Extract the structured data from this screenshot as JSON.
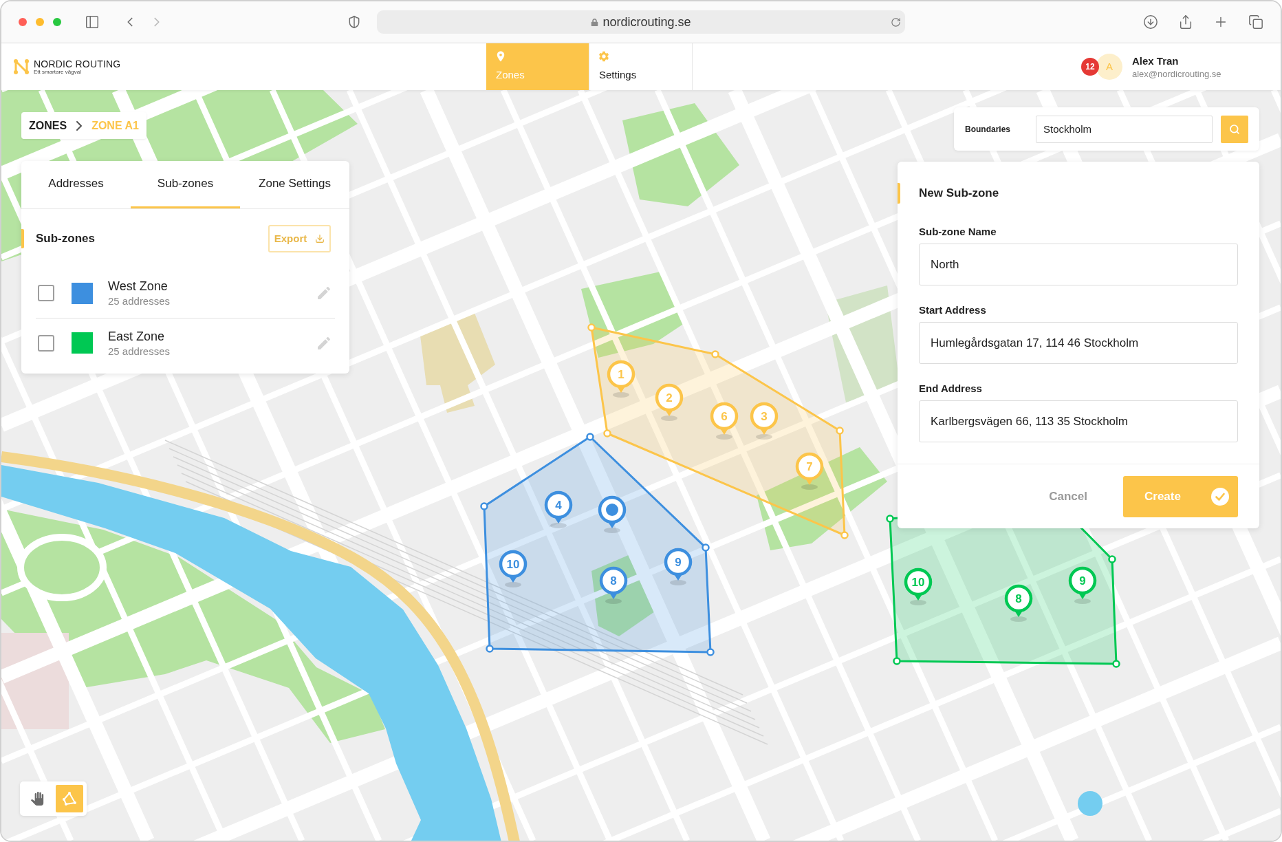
{
  "browser": {
    "url": "nordicrouting.se"
  },
  "header": {
    "brand": "NORDIC ROUTING",
    "tagline": "Ett smartare vägval",
    "nav": [
      {
        "label": "Zones",
        "selected": true
      },
      {
        "label": "Settings",
        "selected": false
      }
    ],
    "user": {
      "notifications": "12",
      "initial": "A",
      "name": "Alex Tran",
      "email": "alex@nordicrouting.se"
    }
  },
  "breadcrumb": [
    {
      "label": "ZONES",
      "current": false
    },
    {
      "label": "ZONE A1",
      "current": true
    }
  ],
  "zone_panel": {
    "tabs": [
      {
        "label": "Addresses",
        "selected": false
      },
      {
        "label": "Sub-zones",
        "selected": true
      },
      {
        "label": "Zone Settings",
        "selected": false
      }
    ],
    "title": "Sub-zones",
    "export": {
      "label": "Export",
      "disabled": true
    },
    "sub_zones": [
      {
        "name": "West Zone",
        "count": "25 addresses",
        "color": "#3d8fdf",
        "checked": false
      },
      {
        "name": "East Zone",
        "count": "25 addresses",
        "color": "#00c853",
        "checked": false
      }
    ]
  },
  "boundaries": {
    "label": "Boundaries",
    "value": "Stockholm"
  },
  "new_sub_zone": {
    "title": "New Sub-zone",
    "fields": [
      {
        "label": "Sub-zone Name",
        "value": "North"
      },
      {
        "label": "Start Address",
        "value": "Humlegårdsgatan 17, 114 46 Stockholm"
      },
      {
        "label": "End Address",
        "value": "Karlbergsvägen 66, 113 35 Stockholm"
      }
    ],
    "cancel": "Cancel",
    "create": "Create"
  },
  "map": {
    "zones": [
      {
        "color": "#fcc54a",
        "pins": [
          {
            "kind": "number",
            "label": "1"
          },
          {
            "kind": "number",
            "label": "2"
          },
          {
            "kind": "number",
            "label": "6"
          },
          {
            "kind": "number",
            "label": "3"
          },
          {
            "kind": "number",
            "label": "7"
          }
        ]
      },
      {
        "color": "#3d8fdf",
        "pins": [
          {
            "kind": "number",
            "label": "4"
          },
          {
            "kind": "dot"
          },
          {
            "kind": "number",
            "label": "10"
          },
          {
            "kind": "number",
            "label": "8"
          },
          {
            "kind": "number",
            "label": "9"
          }
        ]
      },
      {
        "color": "#00c853",
        "pins": [
          {
            "kind": "number",
            "label": "10"
          },
          {
            "kind": "number",
            "label": "8"
          },
          {
            "kind": "number",
            "label": "9"
          }
        ]
      }
    ]
  },
  "tools": [
    {
      "selected": false
    },
    {
      "selected": true
    }
  ]
}
